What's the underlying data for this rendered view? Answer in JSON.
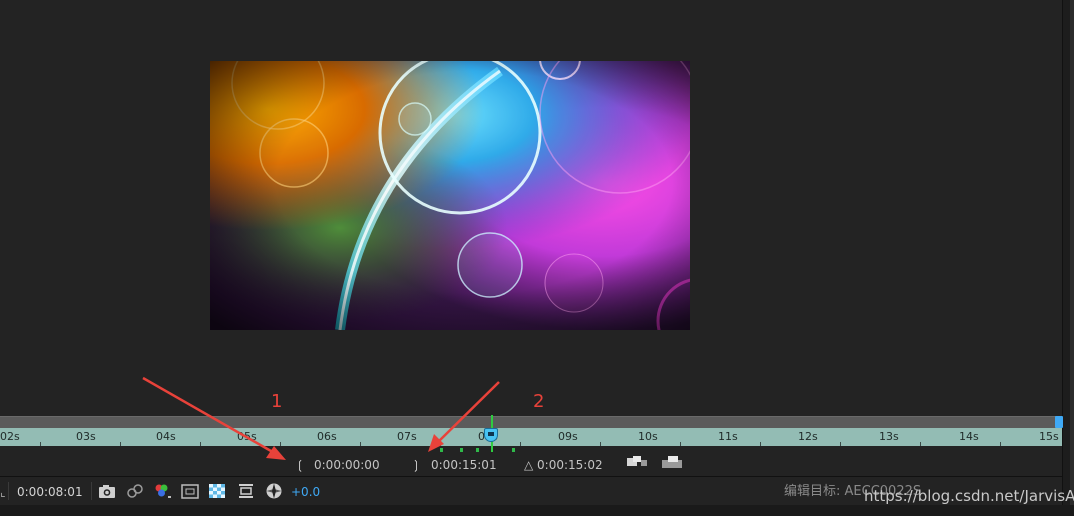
{
  "timeline": {
    "ruler_labels": [
      "02s",
      "03s",
      "04s",
      "05s",
      "06s",
      "07s",
      "08s",
      "09s",
      "10s",
      "11s",
      "12s",
      "13s",
      "14s",
      "15s"
    ],
    "range_start": "0:00:00:00",
    "range_end": "0:00:15:01",
    "range_duration": "△ 0:00:15:02",
    "start_bracket": "❲",
    "end_bracket": "❳"
  },
  "toolbar": {
    "left_glyph": "⌞",
    "current_time": "0:00:08:01",
    "exposure": "+0.0",
    "accent_color": "#3fa9f5",
    "icons": [
      "camera-icon",
      "show-snapshot-icon",
      "channel-icon",
      "region-of-interest-icon",
      "transparency-grid-icon",
      "fit-to-frame-icon",
      "reset-exposure-icon"
    ]
  },
  "annotations": {
    "label_1": "1",
    "label_2": "2",
    "color": "#e8423a"
  },
  "watermark": {
    "cn": "编辑目标: AECC0022S",
    "url": "https://blog.csdn.net/JarvisAI"
  }
}
